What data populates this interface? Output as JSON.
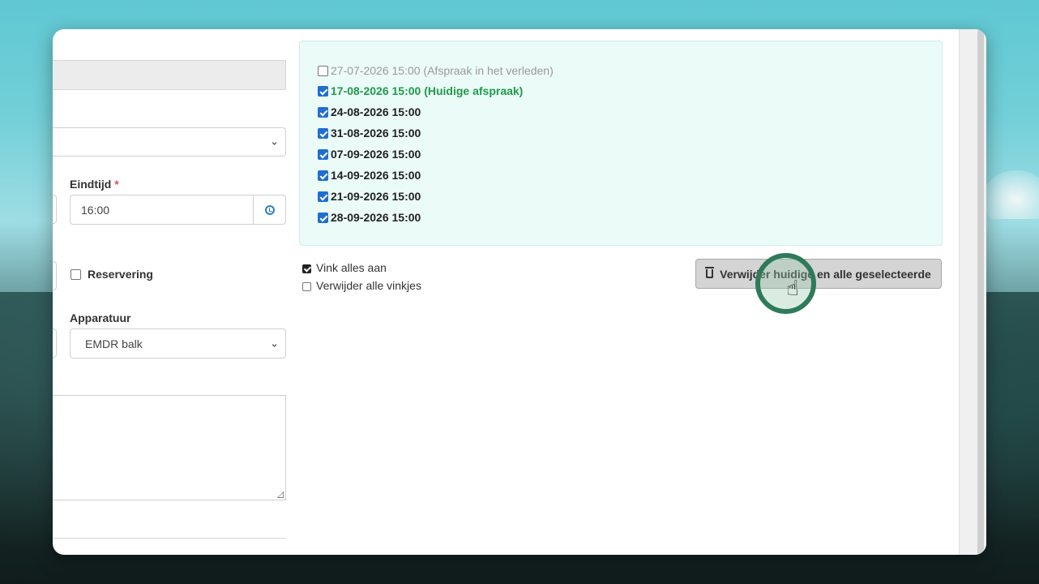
{
  "form": {
    "end_time_label": "Eindtijd",
    "required_mark": "*",
    "end_time_value": "16:00",
    "reservation_label": "Reservering",
    "equipment_label": "Apparatuur",
    "equipment_value": "EMDR balk"
  },
  "appointments": {
    "items": [
      {
        "label": "27-07-2026 15:00 (Afspraak in het verleden)",
        "checked": false,
        "state": "past"
      },
      {
        "label": "17-08-2026 15:00 (Huidige afspraak)",
        "checked": true,
        "state": "current"
      },
      {
        "label": "24-08-2026 15:00",
        "checked": true,
        "state": "future"
      },
      {
        "label": "31-08-2026 15:00",
        "checked": true,
        "state": "future"
      },
      {
        "label": "07-09-2026 15:00",
        "checked": true,
        "state": "future"
      },
      {
        "label": "14-09-2026 15:00",
        "checked": true,
        "state": "future"
      },
      {
        "label": "21-09-2026 15:00",
        "checked": true,
        "state": "future"
      },
      {
        "label": "28-09-2026 15:00",
        "checked": true,
        "state": "future"
      }
    ],
    "select_all_label": "Vink alles aan",
    "deselect_all_label": "Verwijder alle vinkjes",
    "delete_button_label": "Verwijder huidige en alle geselecteerde"
  },
  "colors": {
    "current_appointment": "#1f9a4a",
    "dates_box_bg": "#ebfbf8",
    "cursor_ring": "#2e7a5a"
  },
  "icons": {
    "time_picker": "clock-icon",
    "delete": "trash-icon",
    "pointer": "hand-pointer-icon"
  }
}
